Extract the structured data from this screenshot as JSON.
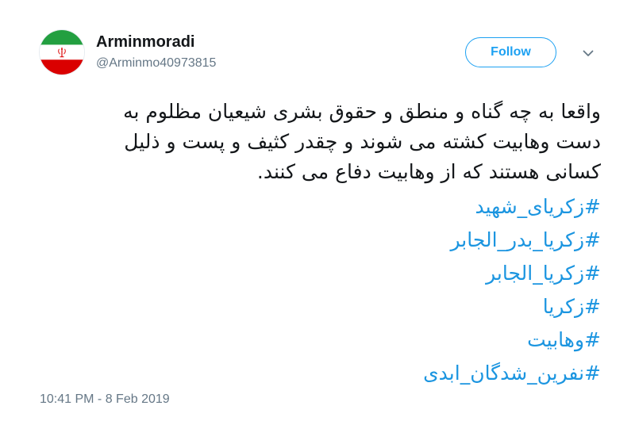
{
  "user": {
    "display_name": "Arminmoradi",
    "handle": "@Arminmo40973815",
    "avatar_icon": "iran-flag-avatar-icon",
    "avatar_colors": {
      "green": "#239f40",
      "white": "#ffffff",
      "red": "#da0000"
    }
  },
  "header": {
    "follow_label": "Follow",
    "menu_icon": "chevron-down-icon"
  },
  "tweet": {
    "text_lines": [
      "واقعا به چه گناه و منطق و حقوق بشری شیعیان مظلوم به",
      "دست وهابیت کشته می شوند و چقدر کثیف و پست و ذلیل",
      "کسانی هستند که از وهابیت دفاع می کنند."
    ],
    "hashtags": [
      "#زکریای_شهید",
      "#زکریا_بدر_الجابر",
      "#زکریا_الجابر",
      "#زکریا",
      "#وهابیت",
      "#نفرین_شدگان_ابدی"
    ],
    "timestamp": "10:41 PM - 8 Feb 2019"
  },
  "colors": {
    "accent": "#1da1f2",
    "hashtag": "#1b95e0",
    "secondary_text": "#657786",
    "primary_text": "#14171a"
  }
}
